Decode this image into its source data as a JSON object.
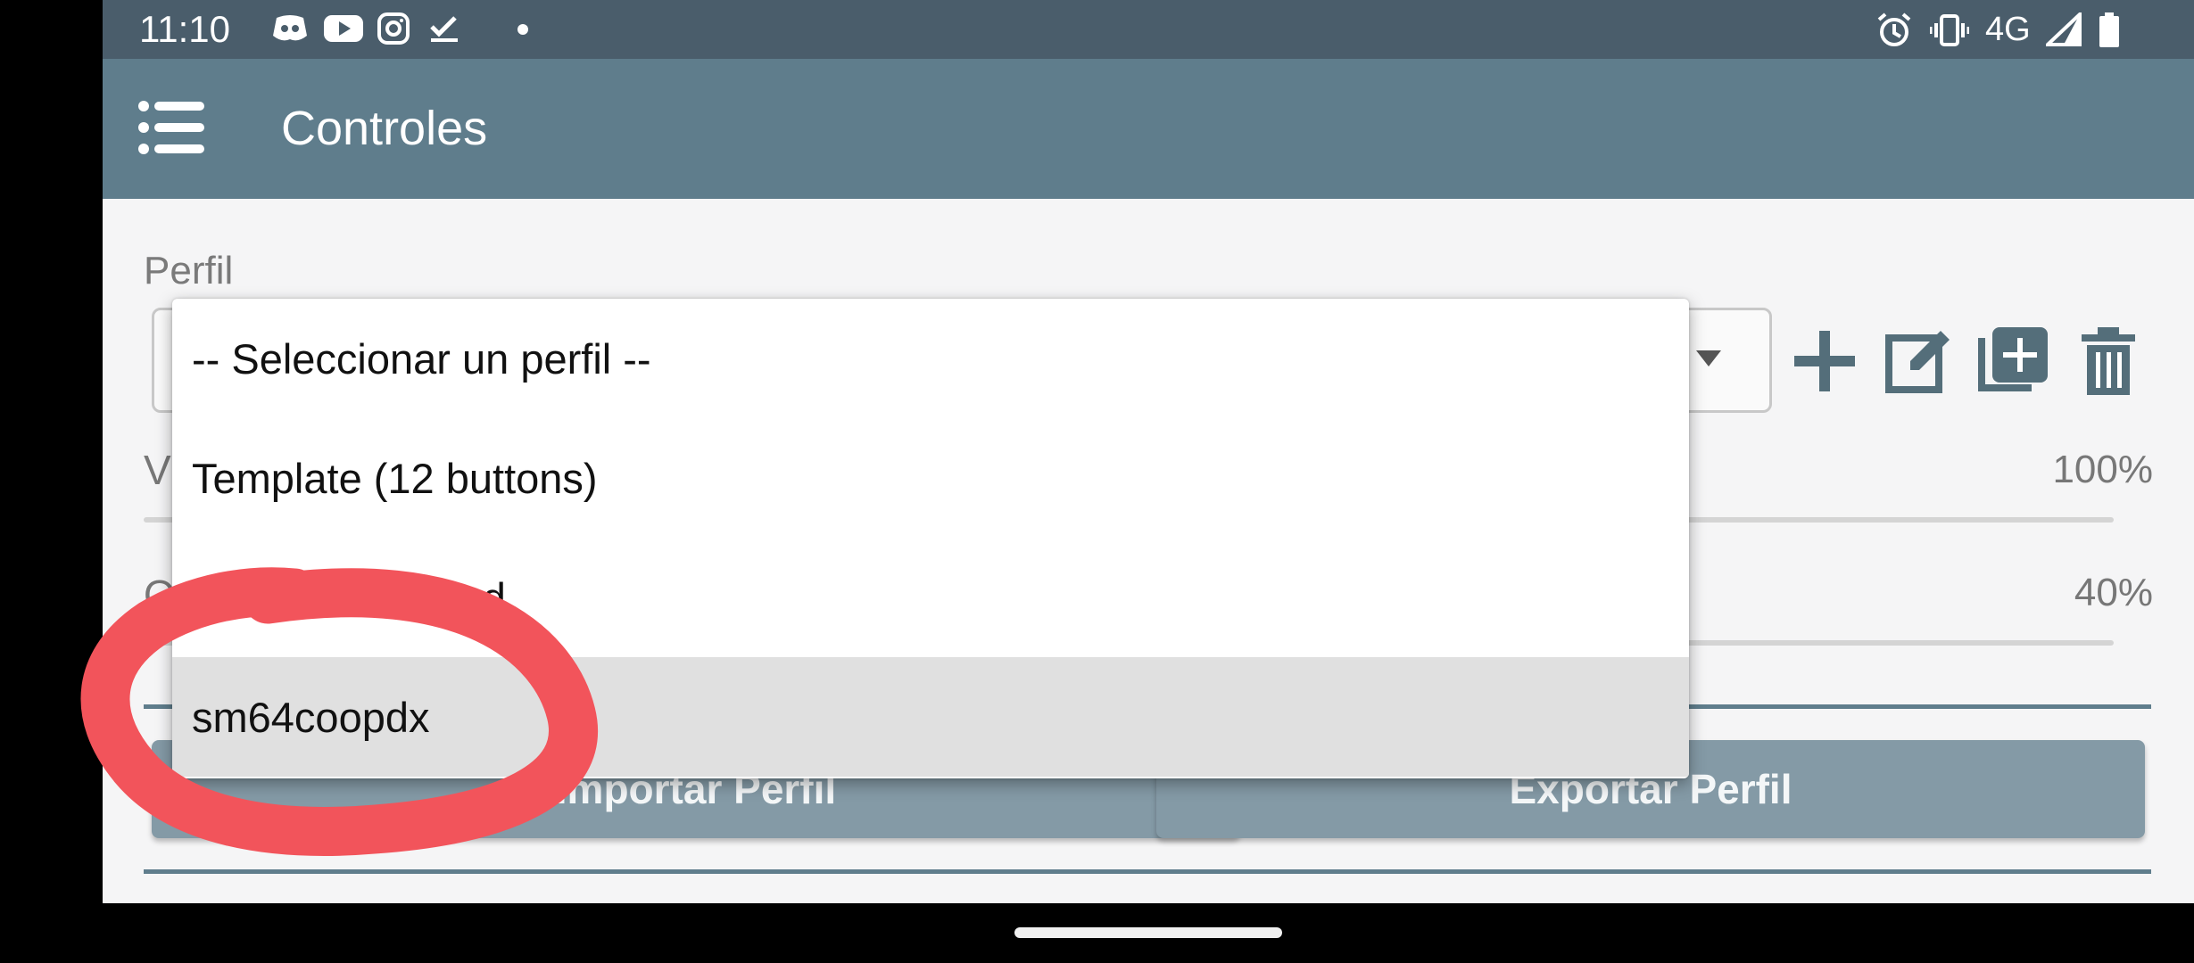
{
  "status_bar": {
    "time": "11:10",
    "left_icons": [
      "discord-icon",
      "youtube-icon",
      "instagram-icon",
      "tasks-check-icon",
      "dot-icon"
    ],
    "right_icons": [
      "alarm-icon",
      "vibrate-icon",
      "signal-icon",
      "battery-icon"
    ],
    "network": "4G"
  },
  "app_bar": {
    "title": "Controles",
    "menu_icon": "menu-list-icon"
  },
  "profile": {
    "label": "Perfil",
    "tools": [
      "add-icon",
      "edit-icon",
      "duplicate-icon",
      "delete-icon"
    ]
  },
  "sliders": [
    {
      "label": "V",
      "value": "100%"
    },
    {
      "label": "O",
      "value": "40%"
    }
  ],
  "buttons": {
    "import": "Importar Perfil",
    "export": "Exportar Perfil"
  },
  "dropdown": {
    "options": [
      "-- Seleccionar un perfil --",
      "Template (12 buttons)",
      "Virtual Gamepad",
      "sm64coopdx"
    ],
    "selected_index": 3
  },
  "colors": {
    "status_bar": "#4a5d6b",
    "app_bar": "#5f7d8c",
    "button": "#849aa6",
    "annotation": "#f2545b"
  }
}
